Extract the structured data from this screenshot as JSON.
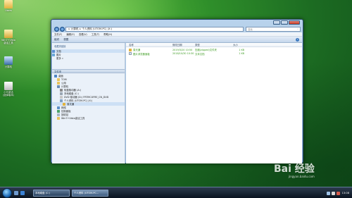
{
  "desktop": {
    "icons": [
      {
        "label": "Users"
      },
      {
        "label": "Win7+Vista\n激活工具"
      },
      {
        "label": "计算机"
      },
      {
        "label": "小马激活\n(选择版本)"
      }
    ]
  },
  "window": {
    "address": {
      "root": "计算机",
      "path": "个人资料 (UTOM-PC) (X:)"
    },
    "search_placeholder": "搜索",
    "menu": [
      "文件(F)",
      "编辑(E)",
      "查看(V)",
      "工具(T)",
      "帮助(H)"
    ],
    "toolbar": {
      "organize": "组织",
      "views": "视图"
    },
    "nav": {
      "fav_header": "收藏夹链接",
      "fav_items": [
        "文档",
        "图片",
        "更多 »"
      ],
      "tree_header": "文件夹",
      "tree_items": [
        "桌面",
        "TOM",
        "公用",
        "计算机",
        "软盘驱动器 (A:)",
        "本地磁盘 (C:)",
        "DVD 驱动器 (D:) FRTMCXFRE_CN_DVD",
        "个人资料 (UTOM-PC) (X:)",
        "易光通",
        "网络",
        "控制面板",
        "回收站",
        "Win7+Vista激活工具"
      ]
    },
    "columns": [
      "名称",
      "修改日期",
      "类型",
      "大小"
    ],
    "files": [
      {
        "name": "易光通",
        "date": "2019/3/20 10:50",
        "type": "压缩(zipped)文件夹",
        "size": "1 KB"
      },
      {
        "name": "图片浏览器面板",
        "date": "2018/10/30 10:30",
        "type": "文本文档",
        "size": "1 KB"
      }
    ]
  },
  "taskbar": {
    "buttons": [
      "本地磁盘 (C:)",
      "个人资料 (UTOM-PC..."
    ],
    "clock": "13:08"
  },
  "watermark": {
    "brand": "Bai 经验",
    "url": "jingyan.baidu.com"
  }
}
